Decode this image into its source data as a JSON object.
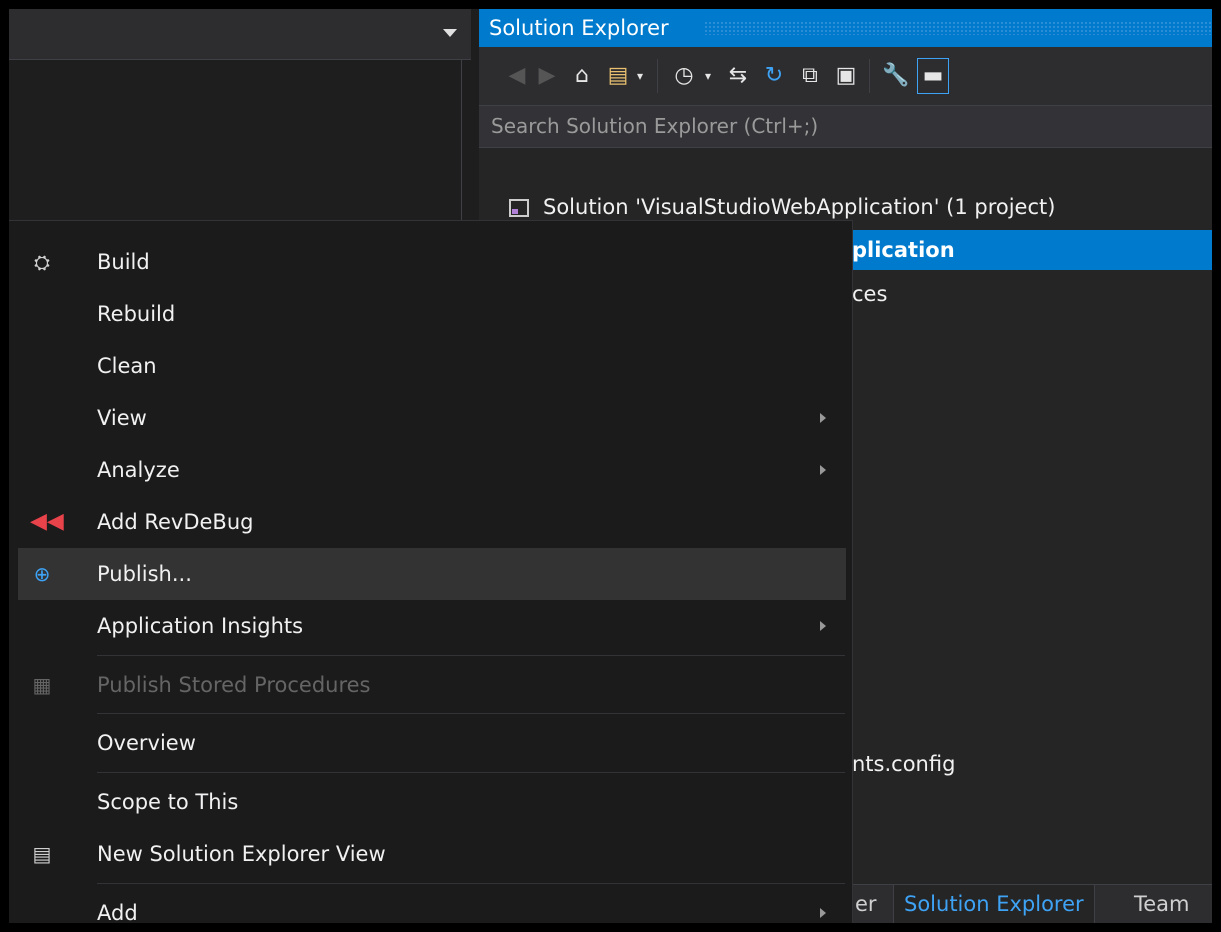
{
  "solution_explorer": {
    "title": "Solution Explorer",
    "search_placeholder": "Search Solution Explorer (Ctrl+;)",
    "tree": [
      {
        "label": "Solution 'VisualStudioWebApplication' (1 project)"
      },
      {
        "label": "plication"
      },
      {
        "label": "ces"
      },
      {
        "label": "nts.config"
      }
    ],
    "tabs": [
      "er",
      "Solution Explorer",
      "Team"
    ]
  },
  "context_menu": {
    "items": [
      {
        "label": "Build",
        "icon": "build-icon"
      },
      {
        "label": "Rebuild"
      },
      {
        "label": "Clean"
      },
      {
        "label": "View",
        "submenu": true
      },
      {
        "label": "Analyze",
        "submenu": true
      },
      {
        "label": "Add RevDeBug",
        "icon": "revdebug-icon"
      },
      {
        "label": "Publish...",
        "icon": "publish-globe-icon",
        "highlighted": true
      },
      {
        "label": "Application Insights",
        "submenu": true
      },
      {
        "label": "Publish Stored Procedures",
        "icon": "stored-procedures-icon",
        "disabled": true
      },
      {
        "label": "Overview"
      },
      {
        "label": "Scope to This"
      },
      {
        "label": "New Solution Explorer View",
        "icon": "new-view-icon"
      },
      {
        "label": "Add",
        "submenu": true
      }
    ]
  },
  "colors": {
    "accent": "#007acc",
    "menu_background": "#1b1b1c",
    "hover": "#333334"
  }
}
